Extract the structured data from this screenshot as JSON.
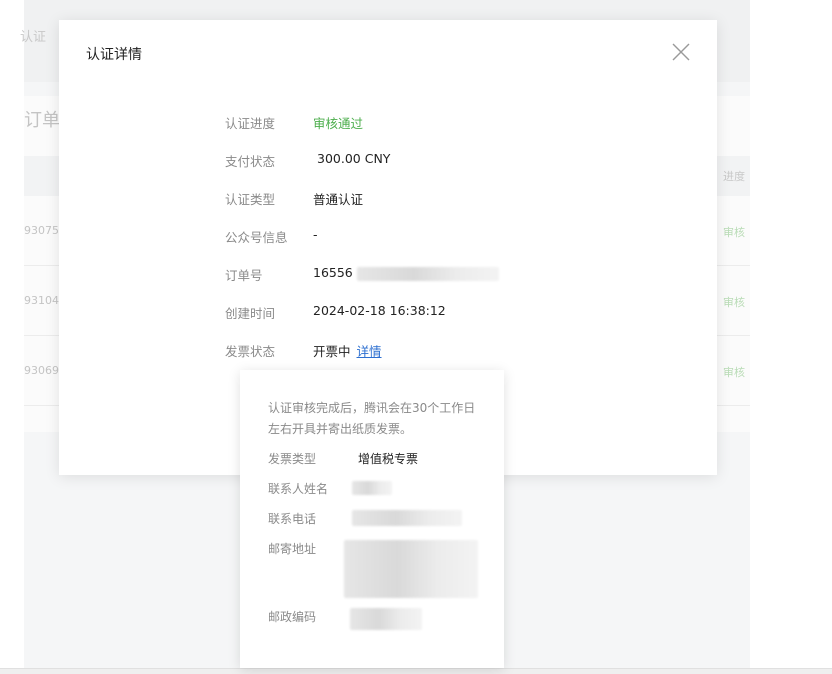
{
  "background": {
    "top_text": "认证",
    "section_title": "订单",
    "table_col_head": "进度",
    "rows": [
      {
        "order_id": "93075",
        "status": "审核"
      },
      {
        "order_id": "93104",
        "status": "审核"
      },
      {
        "order_id": "93069",
        "status": "审核"
      }
    ]
  },
  "modal": {
    "title": "认证详情",
    "close_icon": "close-icon",
    "fields": {
      "progress": {
        "label": "认证进度",
        "value": "审核通过",
        "color": "#4cae4c"
      },
      "payment": {
        "label": "支付状态",
        "value": "300.00 CNY"
      },
      "type": {
        "label": "认证类型",
        "value": "普通认证"
      },
      "account_info": {
        "label": "公众号信息",
        "value": "-"
      },
      "order_no": {
        "label": "订单号",
        "value": "16556"
      },
      "created": {
        "label": "创建时间",
        "value": "2024-02-18 16:38:12"
      },
      "invoice": {
        "label": "发票状态",
        "value": "开票中",
        "link": "详情"
      }
    }
  },
  "popover": {
    "notice": "认证审核完成后，腾讯会在30个工作日左右开具并寄出纸质发票。",
    "fields": {
      "invoice_type": {
        "label": "发票类型",
        "value": "增值税专票"
      },
      "contact_name": {
        "label": "联系人姓名"
      },
      "contact_phone": {
        "label": "联系电话"
      },
      "mail_address": {
        "label": "邮寄地址"
      },
      "postal_code": {
        "label": "邮政编码"
      }
    }
  },
  "colors": {
    "link": "#2d6fd0",
    "success": "#4cae4c"
  }
}
